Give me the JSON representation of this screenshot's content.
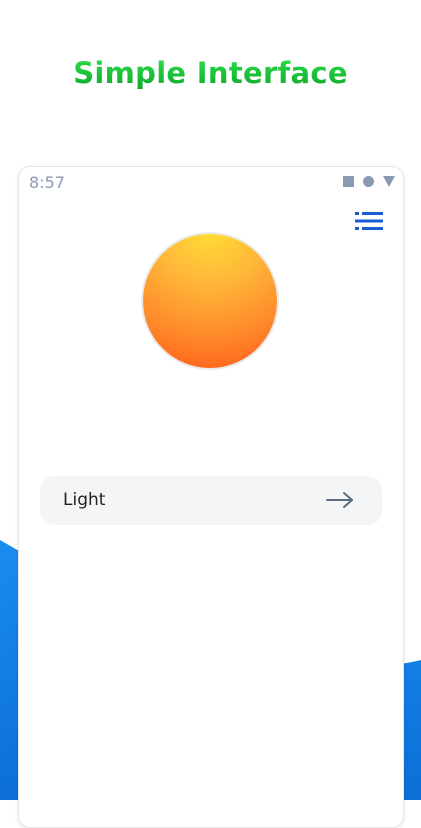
{
  "headline": "Simple Interface",
  "status_bar": {
    "time": "8:57",
    "icons": [
      "stop-square-icon",
      "home-circle-icon",
      "back-triangle-icon"
    ]
  },
  "menu": {
    "icon": "menu-list-icon"
  },
  "theme_preview": {
    "icon": "sun-icon"
  },
  "theme_option": {
    "label": "Light",
    "icon": "arrow-right-icon"
  },
  "colors": {
    "headline_green": "#1ec93a",
    "accent_blue": "#1a5cd6",
    "status_gray": "#8a9ab1",
    "row_background": "#f4f5f7",
    "sun_top": "#ffe034",
    "sun_bottom": "#ff5a18",
    "background_blue": "#1583e6"
  }
}
